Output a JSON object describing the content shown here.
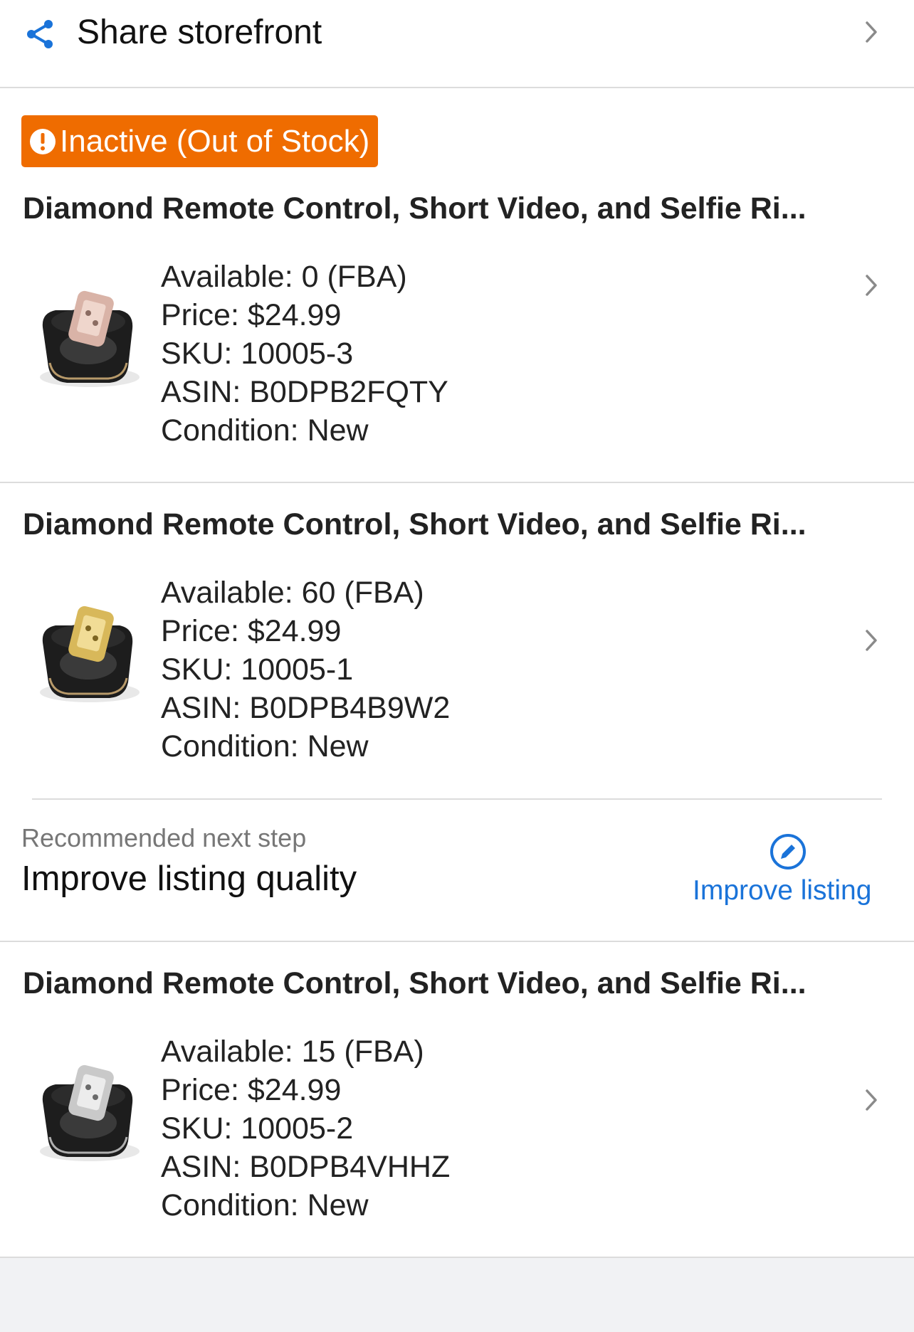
{
  "share": {
    "label": "Share storefront",
    "icon": "share-icon"
  },
  "status_badge": {
    "text": "Inactive (Out of Stock)",
    "color": "#ef6c00",
    "icon": "alert-circle-icon"
  },
  "listings": [
    {
      "title": "Diamond Remote Control, Short Video, and Selfie Ri...",
      "available": "Available: 0 (FBA)",
      "price": "Price: $24.99",
      "sku": "SKU: 10005-3",
      "asin": "ASIN: B0DPB2FQTY",
      "condition": "Condition: New",
      "ring_color": "rose-gold"
    },
    {
      "title": "Diamond Remote Control, Short Video, and Selfie Ri...",
      "available": "Available: 60 (FBA)",
      "price": "Price: $24.99",
      "sku": "SKU: 10005-1",
      "asin": "ASIN: B0DPB4B9W2",
      "condition": "Condition: New",
      "ring_color": "gold"
    },
    {
      "title": "Diamond Remote Control, Short Video, and Selfie Ri...",
      "available": "Available: 15 (FBA)",
      "price": "Price: $24.99",
      "sku": "SKU: 10005-2",
      "asin": "ASIN: B0DPB4VHHZ",
      "condition": "Condition: New",
      "ring_color": "silver"
    }
  ],
  "recommendation": {
    "kicker": "Recommended next step",
    "title": "Improve listing quality",
    "action_label": "Improve listing",
    "action_icon": "edit-pencil-icon",
    "accent": "#1a73d9"
  }
}
